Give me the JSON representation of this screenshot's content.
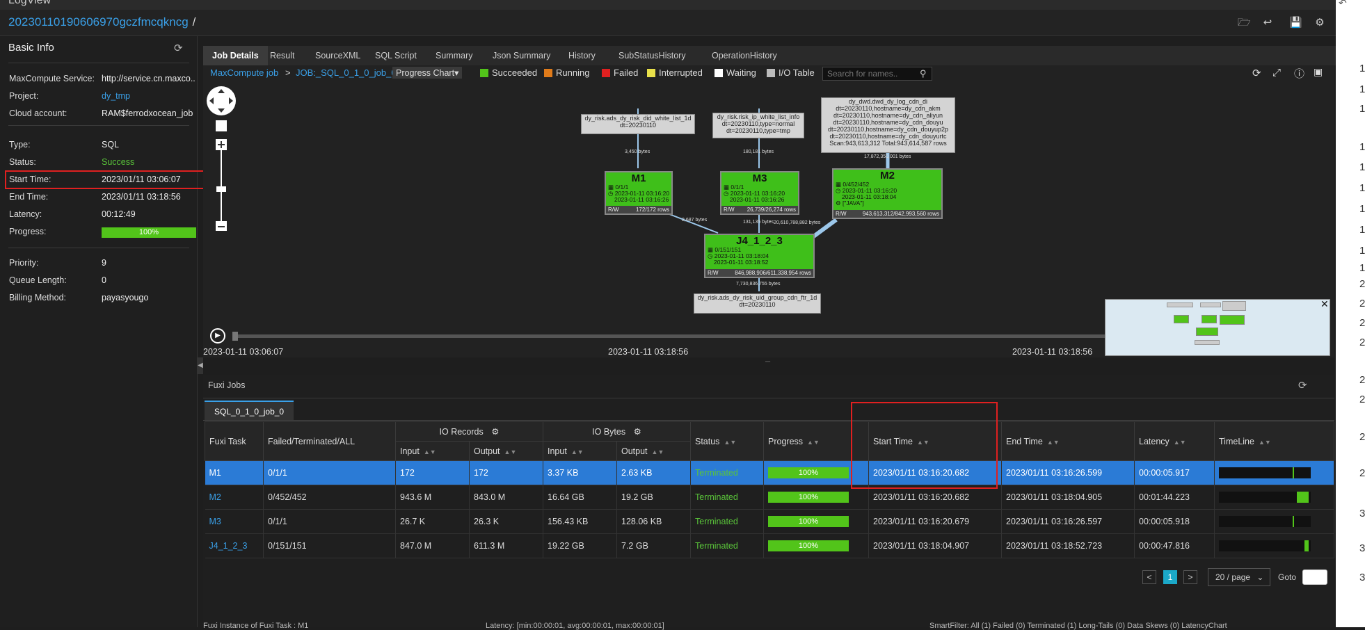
{
  "app": {
    "window_title": "LogView",
    "job_id": "20230110190606970gczfmcqkncg",
    "separator": "/"
  },
  "basic_info": {
    "title": "Basic Info",
    "rows": [
      {
        "label": "MaxCompute Service:",
        "value": "http://service.cn.maxco..."
      },
      {
        "label": "Project:",
        "value": "dy_tmp"
      },
      {
        "label": "Cloud account:",
        "value": "RAM$ferrodxocean_job"
      },
      {
        "label": "Type:",
        "value": "SQL"
      },
      {
        "label": "Status:",
        "value": "Success"
      },
      {
        "label": "Start Time:",
        "value": "2023/01/11 03:06:07"
      },
      {
        "label": "End Time:",
        "value": "2023/01/11 03:18:56"
      },
      {
        "label": "Latency:",
        "value": "00:12:49"
      },
      {
        "label": "Progress:",
        "value": "100%"
      },
      {
        "label": "Priority:",
        "value": "9"
      },
      {
        "label": "Queue Length:",
        "value": "0"
      },
      {
        "label": "Billing Method:",
        "value": "payasyougo"
      }
    ]
  },
  "tabs": [
    "Job Details",
    "Result",
    "SourceXML",
    "SQL Script",
    "Summary",
    "Json Summary",
    "History",
    "SubStatusHistory",
    "OperationHistory"
  ],
  "graph": {
    "breadcrumb_root": "MaxCompute job",
    "breadcrumb_sep": ">",
    "breadcrumb_job": "JOB:_SQL_0_1_0_job_0",
    "view_select": "Progress Chart",
    "legend": [
      {
        "label": "Succeeded",
        "color": "#52c41a"
      },
      {
        "label": "Running",
        "color": "#e07b1a"
      },
      {
        "label": "Failed",
        "color": "#e02020"
      },
      {
        "label": "Interrupted",
        "color": "#e8e04a"
      },
      {
        "label": "Waiting",
        "color": "#ffffff"
      },
      {
        "label": "I/O Table",
        "color": "#bbbbbb"
      }
    ],
    "search_placeholder": "Search for names..",
    "io_nodes": {
      "in1": {
        "l1": "dy_risk.ads_dy_risk_did_white_list_1d",
        "l2": "dt=20230110"
      },
      "in2": {
        "l1": "dy_risk.risk_ip_white_list_info",
        "l2": "dt=20230110,type=normal",
        "l3": "dt=20230110,type=tmp"
      },
      "in3": {
        "l1": "dy_dwd.dwd_dy_log_cdn_di",
        "l2": "dt=20230110,hostname=dy_cdn_akm",
        "l3": "dt=20230110,hostname=dy_cdn_aliyun",
        "l4": "dt=20230110,hostname=dy_cdn_douyu",
        "l5": "dt=20230110,hostname=dy_cdn_douyup2p",
        "l6": "dt=20230110,hostname=dy_cdn_douyurtc",
        "l7": "Scan:943,613,312     Total:943,614,587 rows"
      },
      "out": {
        "l1": "dy_risk.ads_dy_risk_uid_group_cdn_ftr_1d",
        "l2": "dt=20230110"
      }
    },
    "task_nodes": {
      "M1": {
        "name": "M1",
        "a": "0/1/1",
        "b": "2023-01-11 03:16:20",
        "c": "2023-01-11 03:16:26",
        "rw": "R/W",
        "rows": "172/172 rows"
      },
      "M3": {
        "name": "M3",
        "a": "0/1/1",
        "b": "2023-01-11 03:16:20",
        "c": "2023-01-11 03:16:26",
        "rw": "R/W",
        "rows": "26,739/26,274 rows"
      },
      "M2": {
        "name": "M2",
        "a": "0/452/452",
        "b": "2023-01-11 03:16:20",
        "c": "2023-01-11 03:18:04",
        "d": "[\"JAVA\"]",
        "rw": "R/W",
        "rows": "943,613,312/842,993,560 rows"
      },
      "J4": {
        "name": "J4_1_2_3",
        "a": "0/151/151",
        "b": "2023-01-11 03:18:04",
        "c": "2023-01-11 03:18:52",
        "rw": "R/W",
        "rows": "846,988,906/611,338,954 rows"
      }
    },
    "edges": {
      "e1": "3,450 bytes",
      "e2": "180,181 bytes",
      "e3": "17,872,350,001 bytes",
      "e4": "2,687 bytes",
      "e5": "131,135 bytes",
      "e6": "20,610,788,882 bytes",
      "e7": "7,730,836,755 bytes"
    },
    "timeline": {
      "start": "2023-01-11 03:06:07",
      "mid": "2023-01-11 03:18:56",
      "end": "2023-01-11 03:18:56"
    }
  },
  "fuxi": {
    "title": "Fuxi Jobs",
    "subtab": "SQL_0_1_0_job_0",
    "headers": {
      "task": "Fuxi Task",
      "ftl": "Failed/Terminated/ALL",
      "io_records": "IO Records",
      "io_bytes": "IO Bytes",
      "input": "Input",
      "output": "Output",
      "status": "Status",
      "progress": "Progress",
      "start": "Start Time",
      "end": "End Time",
      "latency": "Latency",
      "timeline": "TimeLine"
    },
    "rows": [
      {
        "task": "M1",
        "ftl": "0/1/1",
        "rin": "172",
        "rout": "172",
        "bin": "3.37 KB",
        "bout": "2.63 KB",
        "status": "Terminated",
        "progress": "100%",
        "start": "2023/01/11 03:16:20.682",
        "end": "2023/01/11 03:16:26.599",
        "latency": "00:00:05.917",
        "tl": [
          0.8,
          0.02
        ]
      },
      {
        "task": "M2",
        "ftl": "0/452/452",
        "rin": "943.6 M",
        "rout": "843.0 M",
        "bin": "16.64 GB",
        "bout": "19.2 GB",
        "status": "Terminated",
        "progress": "100%",
        "start": "2023/01/11 03:16:20.682",
        "end": "2023/01/11 03:18:04.905",
        "latency": "00:01:44.223",
        "tl": [
          0.85,
          0.13
        ]
      },
      {
        "task": "M3",
        "ftl": "0/1/1",
        "rin": "26.7 K",
        "rout": "26.3 K",
        "bin": "156.43 KB",
        "bout": "128.06 KB",
        "status": "Terminated",
        "progress": "100%",
        "start": "2023/01/11 03:16:20.679",
        "end": "2023/01/11 03:16:26.597",
        "latency": "00:00:05.918",
        "tl": [
          0.8,
          0.02
        ]
      },
      {
        "task": "J4_1_2_3",
        "ftl": "0/151/151",
        "rin": "847.0 M",
        "rout": "611.3 M",
        "bin": "19.22 GB",
        "bout": "7.2 GB",
        "status": "Terminated",
        "progress": "100%",
        "start": "2023/01/11 03:18:04.907",
        "end": "2023/01/11 03:18:52.723",
        "latency": "00:00:47.816",
        "tl": [
          0.93,
          0.05
        ]
      }
    ],
    "pager": {
      "prev": "<",
      "page": "1",
      "next": ">",
      "per_page": "20 / page",
      "goto": "Goto"
    }
  },
  "footer": {
    "left": "Fuxi Instance of Fuxi Task : M1",
    "mid": "Latency: [min:00:00:01, avg:00:00:01, max:00:00:01]",
    "right": "SmartFilter: All (1)  Failed (0)  Terminated (1)  Long-Tails (0)  Data Skews (0)  LatencyChart"
  },
  "right_strip_lines": [
    "1",
    "1",
    "1",
    "1",
    "1",
    "1",
    "1",
    "1",
    "1",
    "1",
    "2",
    "2",
    "2",
    "2",
    "2",
    "2",
    "2",
    "2",
    "3",
    "3",
    "3"
  ]
}
